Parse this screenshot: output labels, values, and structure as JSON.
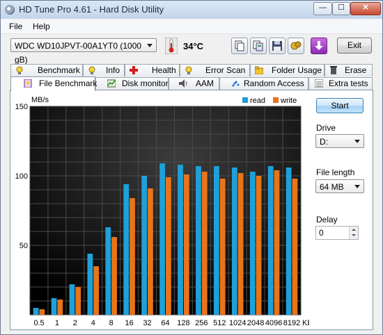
{
  "window": {
    "title": "HD Tune Pro 4.61 - Hard Disk Utility",
    "minimize": "—",
    "maximize": "☐",
    "close": "✕"
  },
  "menu": [
    {
      "label": "File"
    },
    {
      "label": "Help"
    }
  ],
  "toolbar": {
    "drive_select": "WDC WD10JPVT-00A1YT0 (1000 gB)",
    "temperature": "34°C",
    "exit_label": "Exit",
    "icons": [
      "copy-icon",
      "copy-all-icon",
      "save-icon",
      "options-icon",
      "download-icon"
    ]
  },
  "tabs_row1": [
    {
      "label": "Benchmark",
      "icon": "lightbulb-icon"
    },
    {
      "label": "Info",
      "icon": "info-icon"
    },
    {
      "label": "Health",
      "icon": "health-cross-icon"
    },
    {
      "label": "Error Scan",
      "icon": "error-scan-icon"
    },
    {
      "label": "Folder Usage",
      "icon": "folder-icon"
    },
    {
      "label": "Erase",
      "icon": "trash-icon"
    }
  ],
  "tabs_row2": [
    {
      "label": "File Benchmark",
      "icon": "file-benchmark-icon",
      "active": true
    },
    {
      "label": "Disk monitor",
      "icon": "disk-monitor-icon"
    },
    {
      "label": "AAM",
      "icon": "speaker-icon"
    },
    {
      "label": "Random Access",
      "icon": "random-access-icon"
    },
    {
      "label": "Extra tests",
      "icon": "extra-tests-icon"
    }
  ],
  "side": {
    "start_label": "Start",
    "drive_label": "Drive",
    "drive_value": "D:",
    "file_length_label": "File length",
    "file_length_value": "64 MB",
    "delay_label": "Delay",
    "delay_value": "0"
  },
  "chart_data": {
    "type": "bar",
    "ylabel": "MB/s",
    "ylim": [
      0,
      150
    ],
    "yticks": [
      "150",
      "100",
      "50"
    ],
    "x_unit": "KB",
    "categories": [
      "0.5",
      "1",
      "2",
      "4",
      "8",
      "16",
      "32",
      "64",
      "128",
      "256",
      "512",
      "1024",
      "2048",
      "4096",
      "8192"
    ],
    "series": [
      {
        "name": "read",
        "color": "#1ea0d8",
        "values": [
          5,
          12,
          22,
          44,
          63,
          94,
          100,
          109,
          108,
          107,
          107,
          106,
          103,
          107,
          106
        ]
      },
      {
        "name": "write",
        "color": "#e8741a",
        "values": [
          4,
          11,
          20,
          35,
          56,
          84,
          91,
          99,
          101,
          103,
          98,
          102,
          100,
          104,
          98
        ]
      }
    ],
    "grid": true,
    "legend": "top-right",
    "background": "#000000"
  }
}
